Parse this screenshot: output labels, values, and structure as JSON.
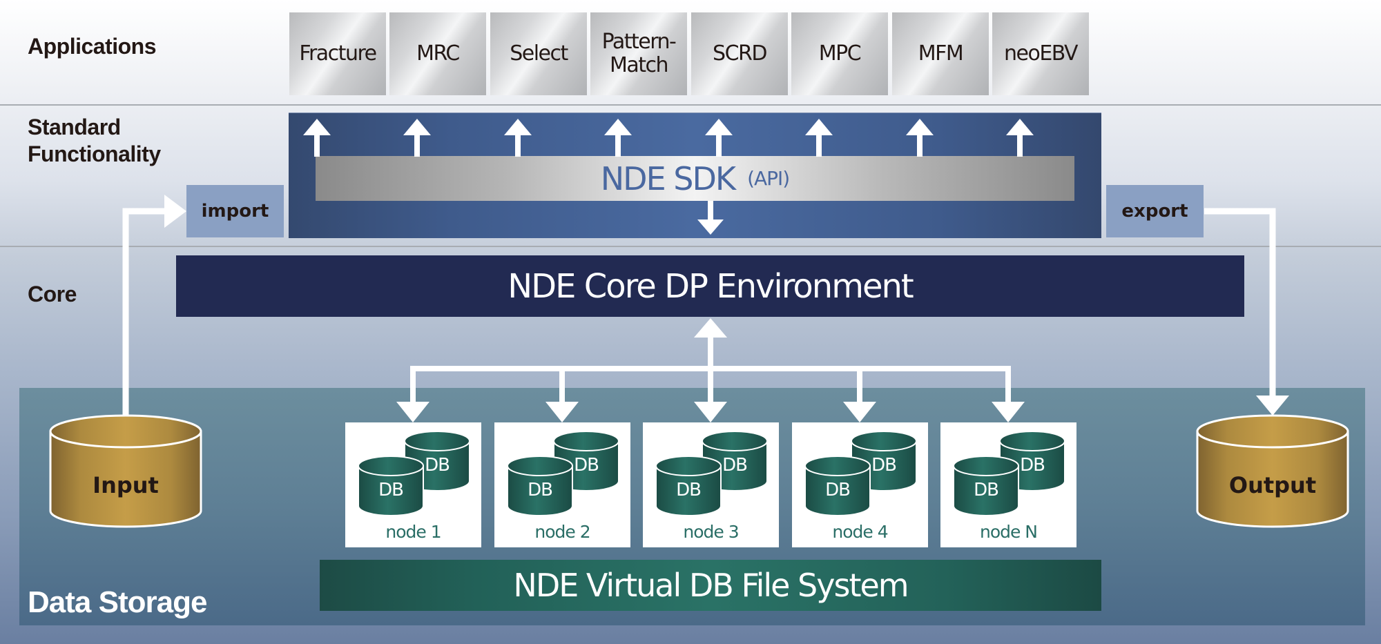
{
  "layers": {
    "applications": "Applications",
    "standard_functionality_line1": "Standard",
    "standard_functionality_line2": "Functionality",
    "core": "Core",
    "data_storage": "Data Storage"
  },
  "applications": [
    {
      "label": "Fracture"
    },
    {
      "label": "MRC"
    },
    {
      "label": "Select"
    },
    {
      "label": "Pattern-\nMatch"
    },
    {
      "label": "SCRD"
    },
    {
      "label": "MPC"
    },
    {
      "label": "MFM"
    },
    {
      "label": "neoEBV"
    }
  ],
  "sdk": {
    "title": "NDE SDK",
    "subtitle": "(API)"
  },
  "io": {
    "import": "import",
    "export": "export"
  },
  "core": {
    "title": "NDE Core DP Environment"
  },
  "storage": {
    "input": "Input",
    "output": "Output",
    "db_label": "DB",
    "nodes": [
      {
        "label": "node 1"
      },
      {
        "label": "node 2"
      },
      {
        "label": "node 3"
      },
      {
        "label": "node 4"
      },
      {
        "label": "node N"
      }
    ],
    "vfs": "NDE Virtual DB File System"
  },
  "colors": {
    "sdk_blue": "#4a6aa0",
    "core_navy": "#222a52",
    "io_box": "#8aa0c3",
    "db_teal": "#2a7266",
    "gold": "#c39b45"
  }
}
